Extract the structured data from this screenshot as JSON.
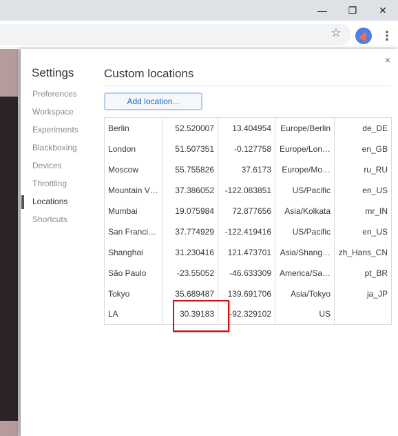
{
  "window": {
    "controls": [
      "—",
      "❐",
      "✕"
    ]
  },
  "toolbar": {
    "star_icon": "☆",
    "menu_icon": "⋮"
  },
  "dialog": {
    "close_label": "×",
    "settings_title": "Settings",
    "nav_items": [
      {
        "label": "Preferences",
        "active": false
      },
      {
        "label": "Workspace",
        "active": false
      },
      {
        "label": "Experiments",
        "active": false
      },
      {
        "label": "Blackboxing",
        "active": false
      },
      {
        "label": "Devices",
        "active": false
      },
      {
        "label": "Throttling",
        "active": false
      },
      {
        "label": "Locations",
        "active": true
      },
      {
        "label": "Shortcuts",
        "active": false
      }
    ],
    "section_title": "Custom locations",
    "add_button_label": "Add location...",
    "locations": [
      {
        "name": "Berlin",
        "lat": "52.520007",
        "lng": "13.404954",
        "tz": "Europe/Berlin",
        "locale": "de_DE"
      },
      {
        "name": "London",
        "lat": "51.507351",
        "lng": "-0.127758",
        "tz": "Europe/Lon…",
        "locale": "en_GB"
      },
      {
        "name": "Moscow",
        "lat": "55.755826",
        "lng": "37.6173",
        "tz": "Europe/Mo…",
        "locale": "ru_RU"
      },
      {
        "name": "Mountain V…",
        "lat": "37.386052",
        "lng": "-122.083851",
        "tz": "US/Pacific",
        "locale": "en_US"
      },
      {
        "name": "Mumbai",
        "lat": "19.075984",
        "lng": "72.877656",
        "tz": "Asia/Kolkata",
        "locale": "mr_IN"
      },
      {
        "name": "San Francisco",
        "lat": "37.774929",
        "lng": "-122.419416",
        "tz": "US/Pacific",
        "locale": "en_US"
      },
      {
        "name": "Shanghai",
        "lat": "31.230416",
        "lng": "121.473701",
        "tz": "Asia/Shang…",
        "locale": "zh_Hans_CN"
      },
      {
        "name": "São Paulo",
        "lat": "-23.55052",
        "lng": "-46.633309",
        "tz": "America/Sa…",
        "locale": "pt_BR"
      },
      {
        "name": "Tokyo",
        "lat": "35.689487",
        "lng": "139.691706",
        "tz": "Asia/Tokyo",
        "locale": "ja_JP"
      },
      {
        "name": "LA",
        "lat": "30.39183",
        "lng": "-92.329102",
        "tz": "US",
        "locale": ""
      }
    ]
  }
}
